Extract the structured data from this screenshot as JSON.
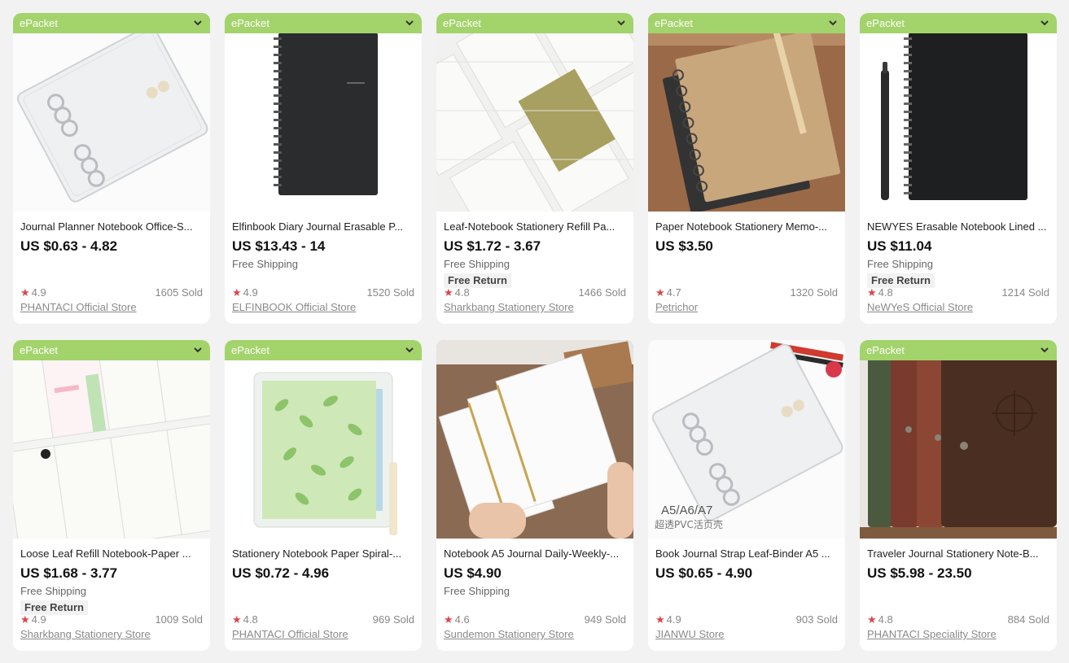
{
  "badge_label": "ePacket",
  "colors": {
    "badge": "#a3d36b",
    "star": "#e0434a",
    "background": "#f2f2f2"
  },
  "products": [
    {
      "title": "Journal Planner Notebook Office-S...",
      "price": "US $0.63 - 4.82",
      "shipping": "",
      "free_return": "",
      "rating": "4.9",
      "sold": "1605 Sold",
      "store": "PHANTACI Official Store",
      "badge": true
    },
    {
      "title": "Elfinbook Diary Journal Erasable P...",
      "price": "US $13.43 - 14",
      "shipping": "Free Shipping",
      "free_return": "",
      "rating": "4.9",
      "sold": "1520 Sold",
      "store": "ELFINBOOK Official Store",
      "badge": true
    },
    {
      "title": "Leaf-Notebook Stationery Refill Pa...",
      "price": "US $1.72 - 3.67",
      "shipping": "Free Shipping",
      "free_return": "Free Return",
      "rating": "4.8",
      "sold": "1466 Sold",
      "store": "Sharkbang Stationery Store",
      "badge": true
    },
    {
      "title": "Paper Notebook Stationery Memo-...",
      "price": "US $3.50",
      "shipping": "",
      "free_return": "",
      "rating": "4.7",
      "sold": "1320 Sold",
      "store": "Petrichor",
      "badge": true
    },
    {
      "title": "NEWYES Erasable Notebook Lined ...",
      "price": "US $11.04",
      "shipping": "Free Shipping",
      "free_return": "Free Return",
      "rating": "4.8",
      "sold": "1214 Sold",
      "store": "NeWYeS Official Store",
      "badge": true
    },
    {
      "title": "Loose Leaf Refill Notebook-Paper ...",
      "price": "US $1.68 - 3.77",
      "shipping": "Free Shipping",
      "free_return": "Free Return",
      "rating": "4.9",
      "sold": "1009 Sold",
      "store": "Sharkbang Stationery Store",
      "badge": true
    },
    {
      "title": "Stationery Notebook Paper Spiral-...",
      "price": "US $0.72 - 4.96",
      "shipping": "",
      "free_return": "",
      "rating": "4.8",
      "sold": "969 Sold",
      "store": "PHANTACI Official Store",
      "badge": true
    },
    {
      "title": "Notebook A5 Journal Daily-Weekly-...",
      "price": "US $4.90",
      "shipping": "Free Shipping",
      "free_return": "",
      "rating": "4.6",
      "sold": "949 Sold",
      "store": "Sundemon  Stationery Store",
      "badge": false
    },
    {
      "title": "Book Journal Strap Leaf-Binder A5 ...",
      "price": "US $0.65 - 4.90",
      "shipping": "",
      "free_return": "",
      "rating": "4.9",
      "sold": "903 Sold",
      "store": "JIANWU Store",
      "badge": false,
      "image_caption_1": "A5/A6/A7",
      "image_caption_2": "超透PVC活页壳"
    },
    {
      "title": "Traveler Journal Stationery Note-B...",
      "price": "US $5.98 - 23.50",
      "shipping": "",
      "free_return": "",
      "rating": "4.8",
      "sold": "884 Sold",
      "store": "PHANTACI Speciality Store",
      "badge": true
    }
  ]
}
